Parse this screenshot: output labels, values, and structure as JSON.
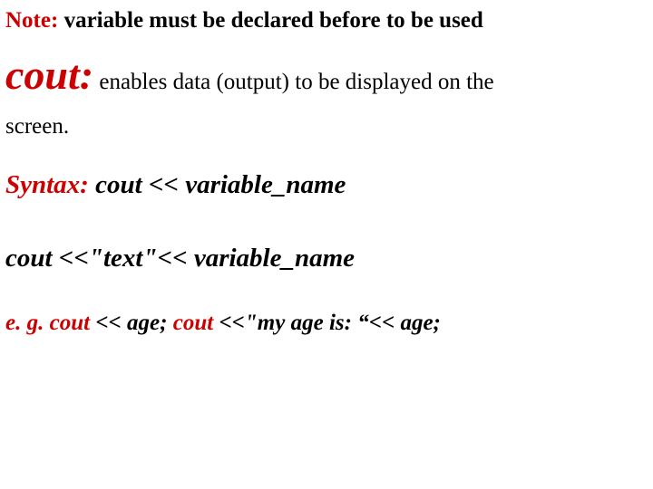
{
  "note": {
    "label": "Note:",
    "text": " variable must be declared before to be used"
  },
  "cout": {
    "heading": "cout:",
    "desc_part1": " enables data (output) to be displayed on the",
    "desc_part2": "screen."
  },
  "syntax": {
    "label": "Syntax: ",
    "code": "cout << variable_name"
  },
  "cout_line2": "cout <<\"text\"<< variable_name",
  "example": {
    "label": "e. g. ",
    "ex1_a": "cout",
    "ex1_b": " << age; ",
    "ex2_a": "cout",
    "ex2_b": " <<\"my age is: “<< age;"
  }
}
